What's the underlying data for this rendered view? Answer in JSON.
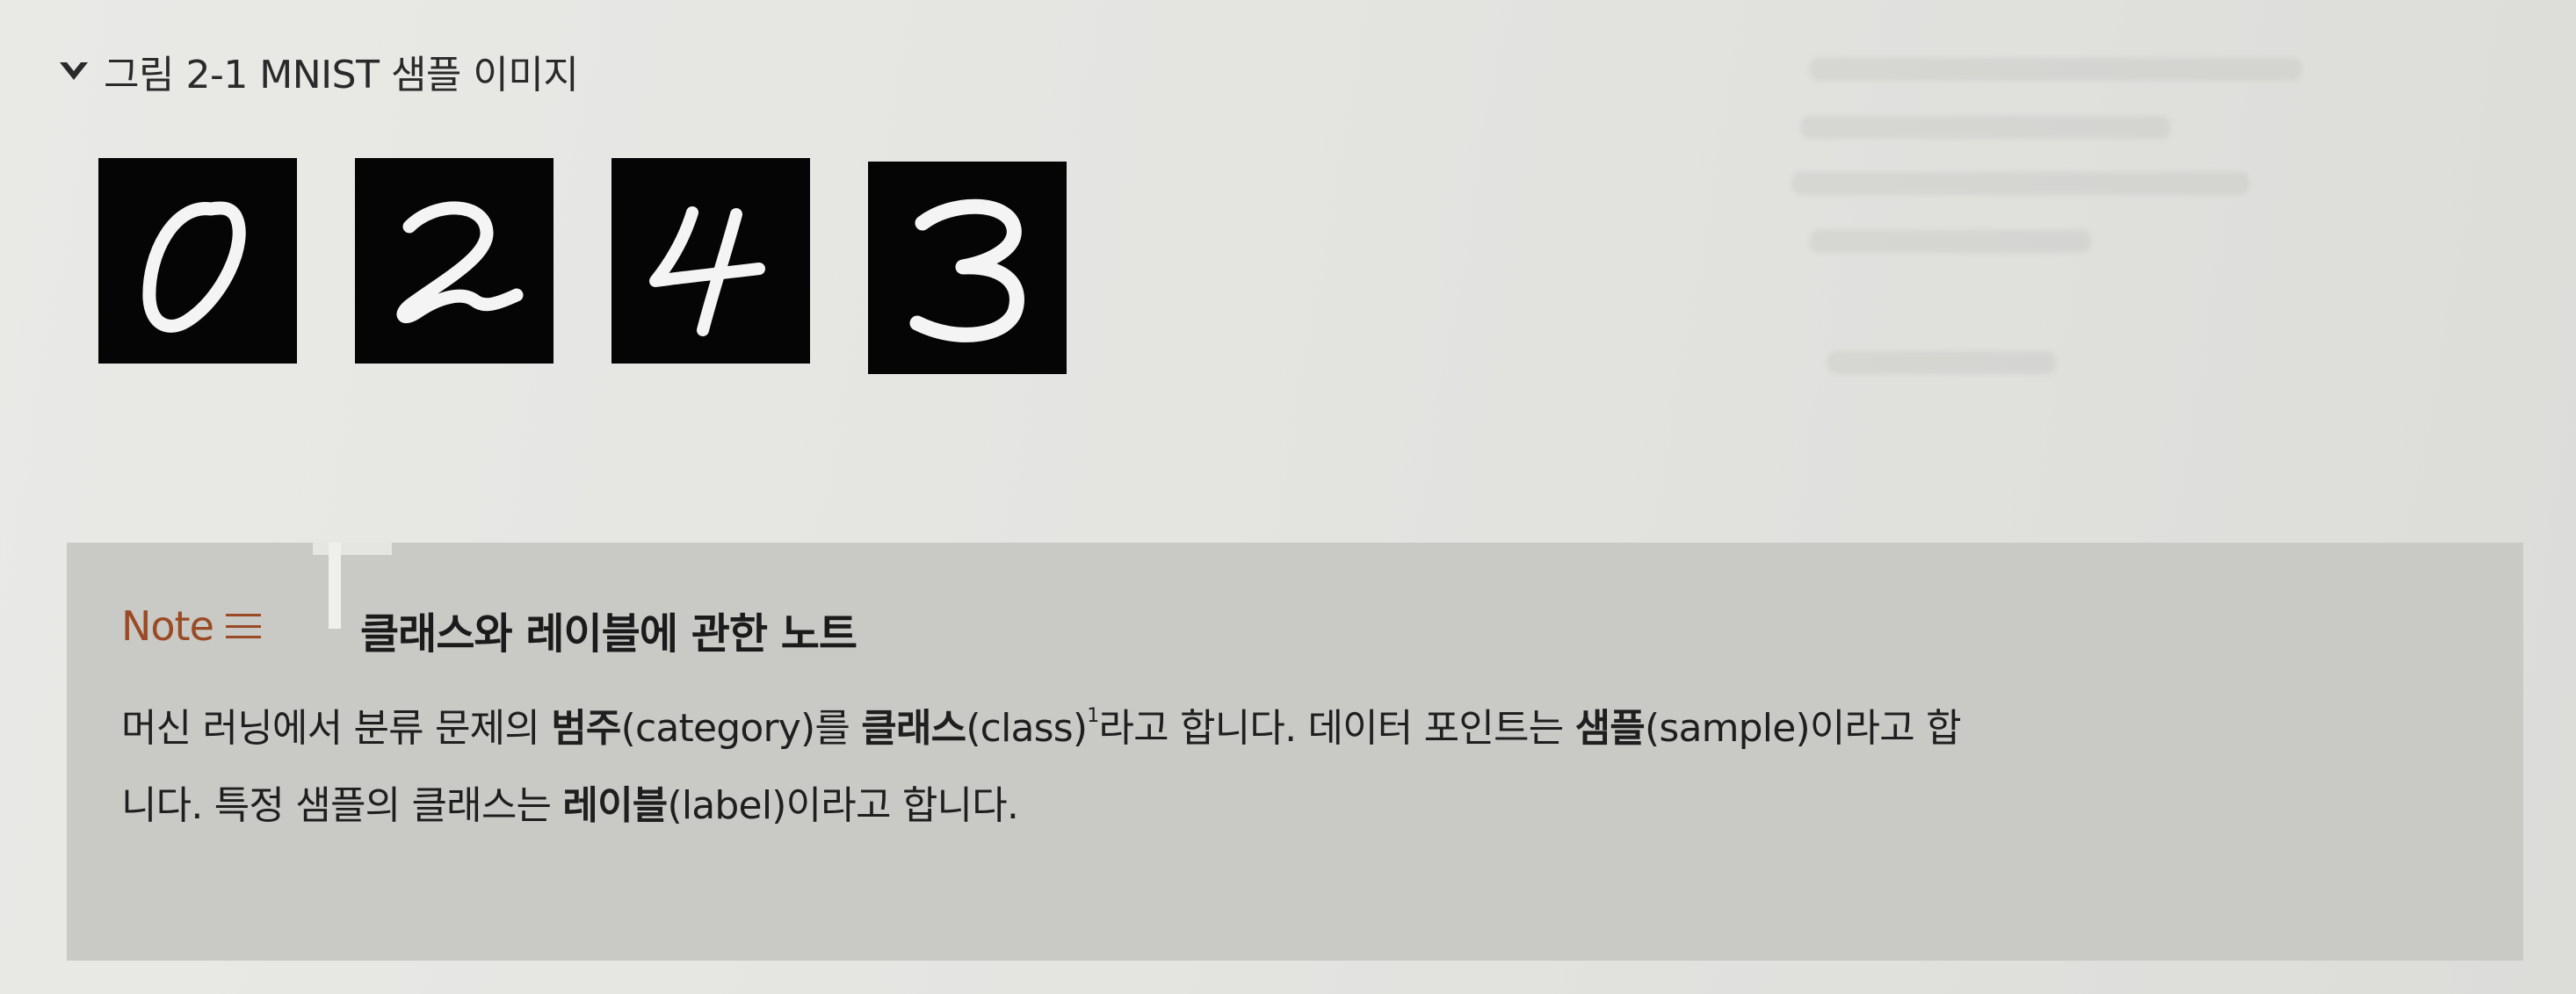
{
  "figure": {
    "caption": "그림 2-1 MNIST 샘플 이미지",
    "digits": [
      "0",
      "2",
      "4",
      "3"
    ]
  },
  "note": {
    "label": "Note",
    "title": "클래스와 레이블에 관한 노트",
    "line1": {
      "t1": "머신 러닝에서 분류 문제의 ",
      "b1": "범주",
      "t2": "(category)를 ",
      "b2": "클래스",
      "t3": "(class)",
      "footnote": "1",
      "t4": "라고 합니다. 데이터 포인트는 ",
      "b3": "샘플",
      "t5": "(sample)이라고 합"
    },
    "line2": {
      "t1": "니다. 특정 샘플의 클래스는 ",
      "b1": "레이블",
      "t2": "(label)이라고 합니다."
    }
  }
}
